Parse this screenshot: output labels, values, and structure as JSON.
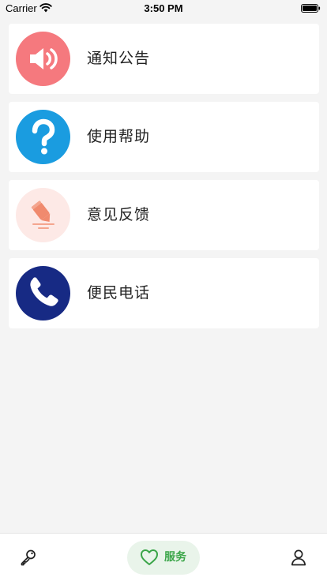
{
  "status_bar": {
    "carrier": "Carrier",
    "time": "3:50 PM"
  },
  "menu": {
    "items": [
      {
        "label": "通知公告",
        "icon": "speaker-icon",
        "color": "#f5797e"
      },
      {
        "label": "使用帮助",
        "icon": "question-mark-icon",
        "color": "#1a9ce0"
      },
      {
        "label": "意见反馈",
        "icon": "pencil-feedback-icon",
        "color": "#fde9e6"
      },
      {
        "label": "便民电话",
        "icon": "phone-icon",
        "color": "#172a84"
      }
    ]
  },
  "tab_bar": {
    "left_icon": "key-icon",
    "service_label": "服务",
    "service_icon": "heart-icon",
    "right_icon": "user-icon",
    "active_color": "#3aa548"
  }
}
